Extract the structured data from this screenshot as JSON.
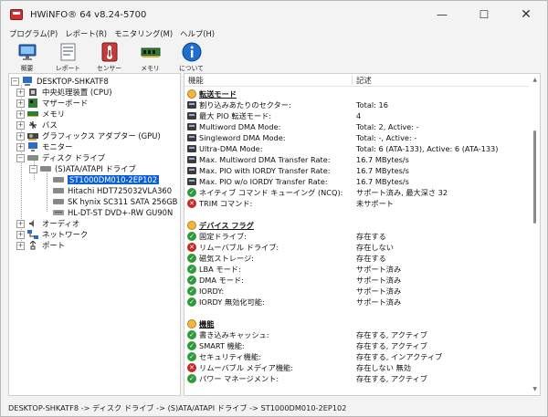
{
  "window": {
    "title": "HWiNFO® 64 v8.24-5700",
    "controls": {
      "minimize": "—",
      "maximize": "☐",
      "close": "✕"
    }
  },
  "menu": [
    "プログラム(P)",
    "レポート(R)",
    "モニタリング(M)",
    "ヘルプ(H)"
  ],
  "toolbar": [
    {
      "label": "概要",
      "icon": "monitor-icon"
    },
    {
      "label": "レポート",
      "icon": "report-icon"
    },
    {
      "label": "センサー",
      "icon": "thermometer-icon"
    },
    {
      "label": "メモリ",
      "icon": "memory-icon"
    },
    {
      "label": "について",
      "icon": "info-icon"
    }
  ],
  "tree": {
    "root": "DESKTOP-SHKATF8",
    "items": [
      {
        "label": "中央処理装置 (CPU)",
        "icon": "cpu-icon"
      },
      {
        "label": "マザーボード",
        "icon": "motherboard-icon"
      },
      {
        "label": "メモリ",
        "icon": "memory-icon"
      },
      {
        "label": "バス",
        "icon": "bus-icon"
      },
      {
        "label": "グラフィックス アダプター (GPU)",
        "icon": "gpu-icon"
      },
      {
        "label": "モニター",
        "icon": "monitor-icon"
      },
      {
        "label": "ディスク ドライブ",
        "icon": "disk-icon"
      },
      {
        "label": "(S)ATA/ATAPI ドライブ",
        "icon": "drive-icon"
      },
      {
        "label": "ST1000DM010-2EP102",
        "icon": "drive-icon"
      },
      {
        "label": "Hitachi HDT725032VLA360",
        "icon": "drive-icon"
      },
      {
        "label": "SK hynix SC311 SATA 256GB",
        "icon": "drive-icon"
      },
      {
        "label": "HL-DT-ST DVD+-RW GU90N",
        "icon": "optical-drive-icon"
      },
      {
        "label": "オーディオ",
        "icon": "audio-icon"
      },
      {
        "label": "ネットワーク",
        "icon": "network-icon"
      },
      {
        "label": "ポート",
        "icon": "port-icon"
      }
    ]
  },
  "details": {
    "col_feature": "機能",
    "col_description": "記述",
    "rows": [
      {
        "type": "section",
        "label": "転送モード",
        "value": ""
      },
      {
        "type": "prop",
        "label": "割り込みあたりのセクター:",
        "value": "Total: 16"
      },
      {
        "type": "prop",
        "label": "最大 PIO 転送モード:",
        "value": "4"
      },
      {
        "type": "prop",
        "label": "Multiword DMA Mode:",
        "value": "Total: 2, Active: -"
      },
      {
        "type": "prop",
        "label": "Singleword DMA Mode:",
        "value": "Total: -, Active: -"
      },
      {
        "type": "prop",
        "label": "Ultra-DMA Mode:",
        "value": "Total: 6 (ATA-133), Active: 6 (ATA-133)"
      },
      {
        "type": "prop",
        "label": "Max. Multiword DMA Transfer Rate:",
        "value": "16.7 MBytes/s"
      },
      {
        "type": "prop",
        "label": "Max. PIO with IORDY Transfer Rate:",
        "value": "16.7 MBytes/s"
      },
      {
        "type": "prop",
        "label": "Max. PIO w/o IORDY Transfer Rate:",
        "value": "16.7 MBytes/s"
      },
      {
        "type": "ok",
        "label": "ネイティブ コマンド キューイング (NCQ):",
        "value": "サポート済み, 最大深さ 32"
      },
      {
        "type": "err",
        "label": "TRIM コマンド:",
        "value": "未サポート"
      },
      {
        "type": "blank",
        "label": "",
        "value": ""
      },
      {
        "type": "section",
        "label": "デバイス フラグ",
        "value": ""
      },
      {
        "type": "ok",
        "label": "固定ドライブ:",
        "value": "存在する"
      },
      {
        "type": "err",
        "label": "リムーバブル ドライブ:",
        "value": "存在しない"
      },
      {
        "type": "ok",
        "label": "磁気ストレージ:",
        "value": "存在する"
      },
      {
        "type": "ok",
        "label": "LBA モード:",
        "value": "サポート済み"
      },
      {
        "type": "ok",
        "label": "DMA モード:",
        "value": "サポート済み"
      },
      {
        "type": "ok",
        "label": "IORDY:",
        "value": "サポート済み"
      },
      {
        "type": "ok",
        "label": "IORDY 無効化可能:",
        "value": "サポート済み"
      },
      {
        "type": "blank",
        "label": "",
        "value": ""
      },
      {
        "type": "section",
        "label": "機能",
        "value": ""
      },
      {
        "type": "ok",
        "label": "書き込みキャッシュ:",
        "value": "存在する, アクティブ"
      },
      {
        "type": "ok",
        "label": "SMART 機能:",
        "value": "存在する, アクティブ"
      },
      {
        "type": "ok",
        "label": "セキュリティ機能:",
        "value": "存在する, インアクティブ"
      },
      {
        "type": "err",
        "label": "リムーバブル メディア機能:",
        "value": "存在しない 無効"
      },
      {
        "type": "ok",
        "label": "パワー マネージメント:",
        "value": "存在する, アクティブ"
      }
    ]
  },
  "status": "DESKTOP-SHKATF8 -> ディスク ドライブ -> (S)ATA/ATAPI ドライブ -> ST1000DM010-2EP102",
  "colors": {
    "selection": "#0b5fd8",
    "ok": "#2e9b3a",
    "error": "#c62828",
    "section": "#f5b63a"
  }
}
